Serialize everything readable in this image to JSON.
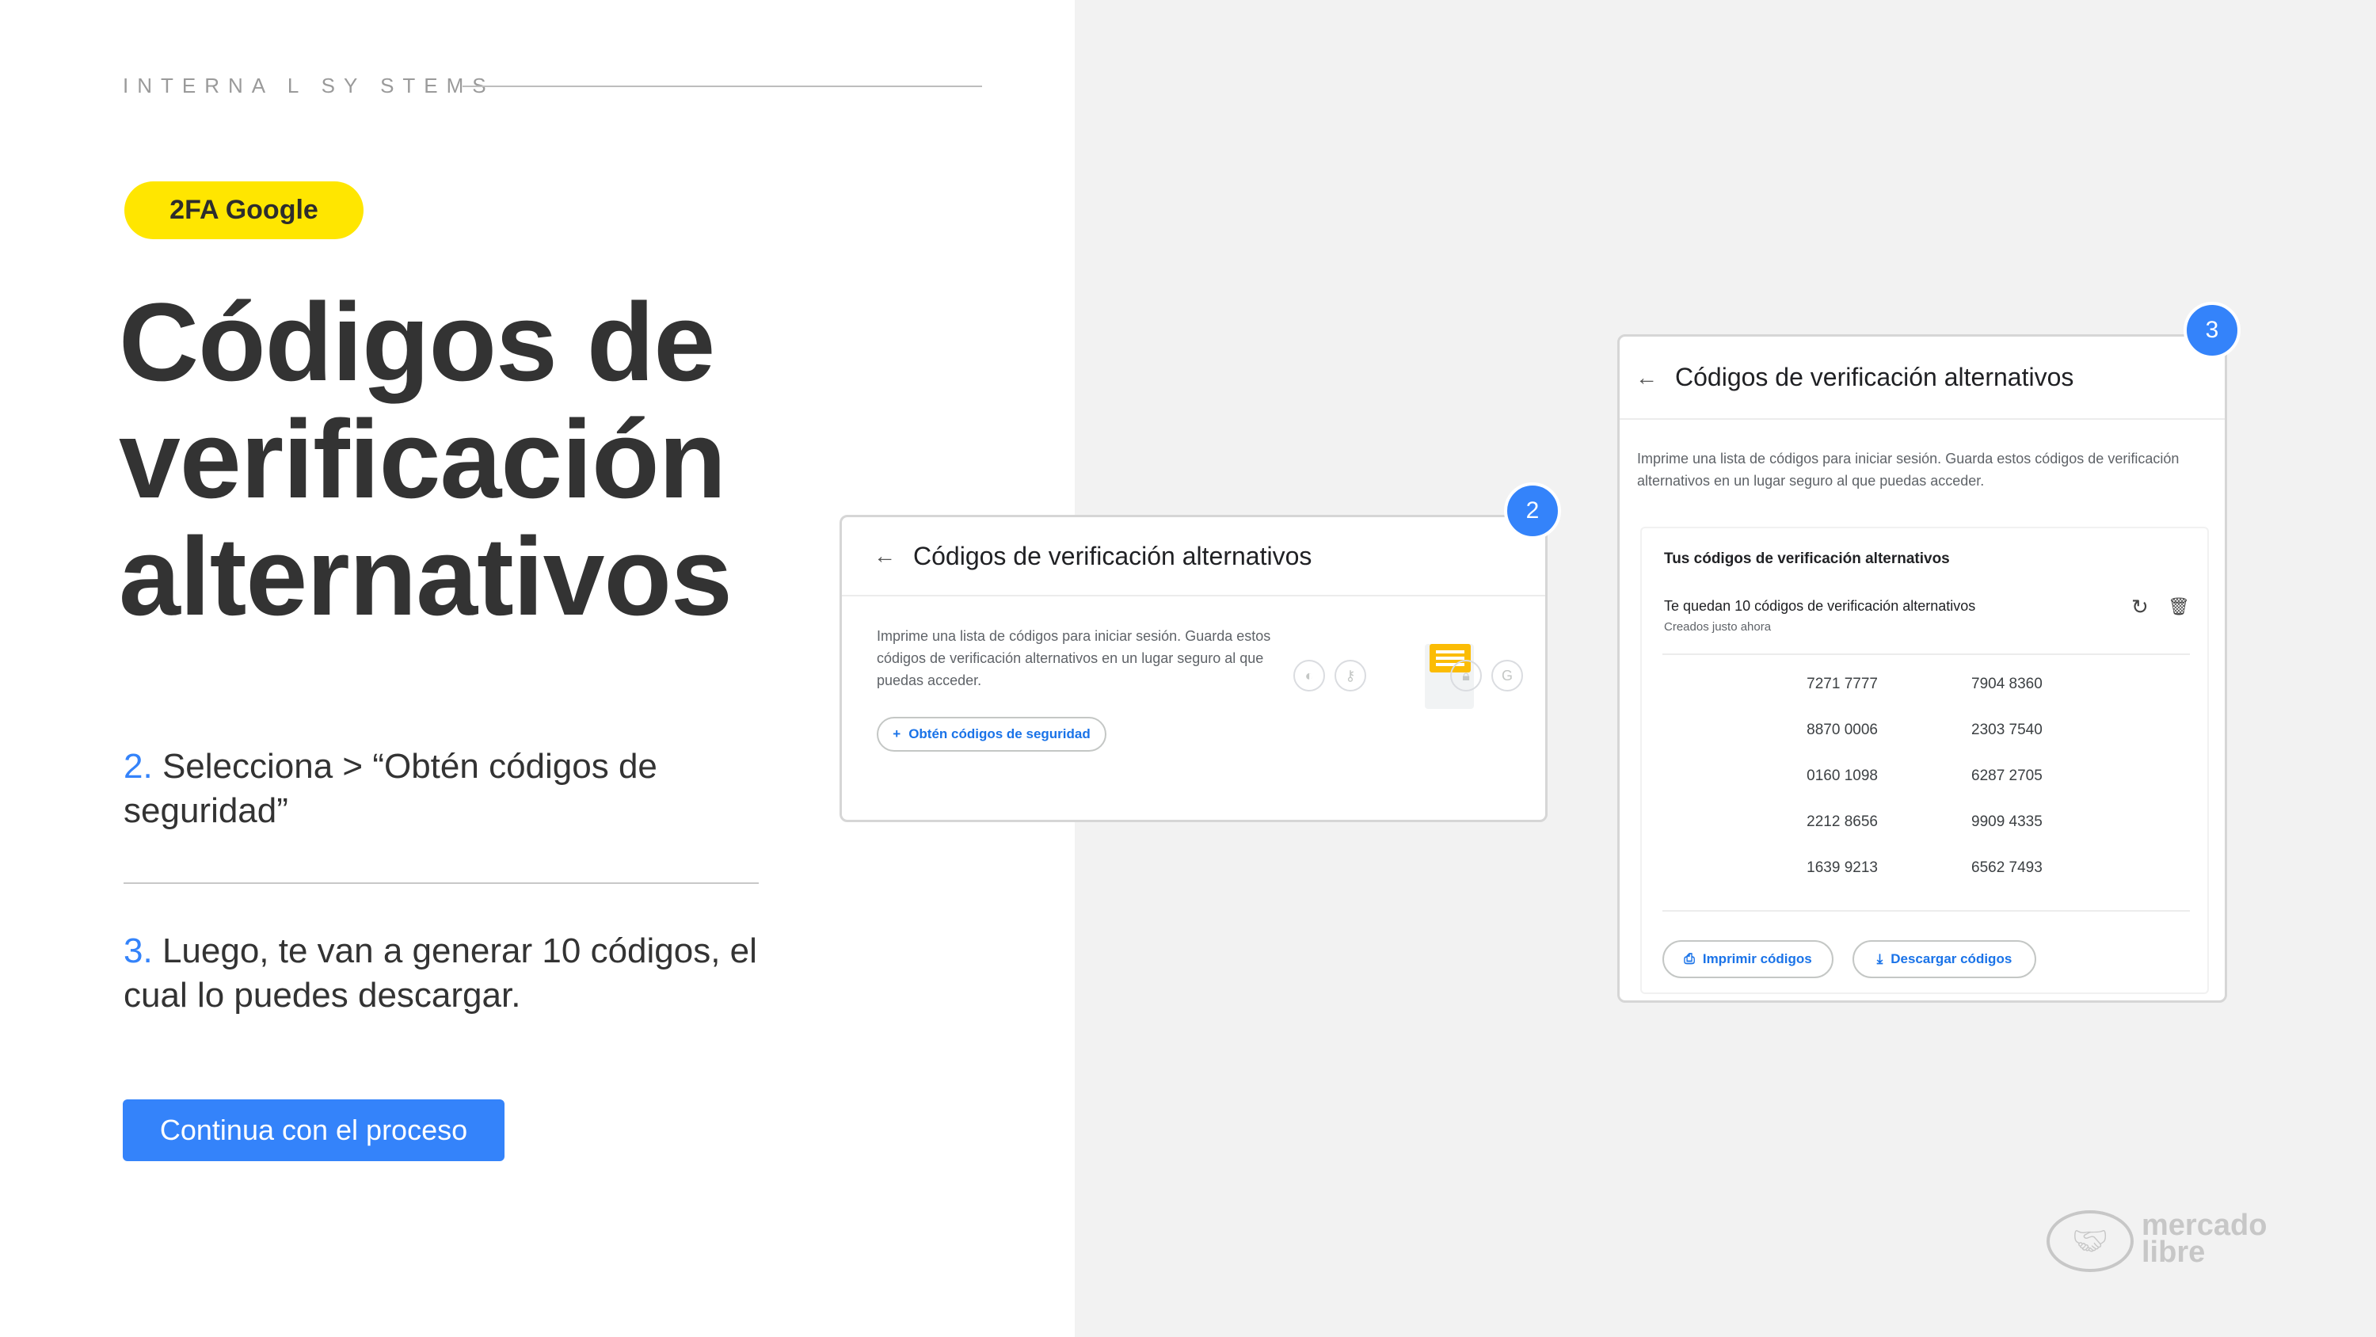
{
  "header": {
    "kicker": "INTERNA L SY STEMS",
    "tag": "2FA Google"
  },
  "title": {
    "line1": "Códigos de",
    "line2": "verificación",
    "line3": "alternativos"
  },
  "steps": [
    {
      "num": "2.",
      "text": "Selecciona > “Obtén códigos de seguridad”"
    },
    {
      "num": "3.",
      "text": "Luego, te van a generar 10 códigos, el cual lo puedes descargar."
    }
  ],
  "cta": {
    "label": "Continua con el proceso"
  },
  "card2": {
    "badge": "2",
    "title": "Códigos de verificación alternativos",
    "description": "Imprime una lista de códigos para iniciar sesión. Guarda estos códigos de verificación alternativos en un lugar seguro al que puedas acceder.",
    "button": "Obtén códigos de seguridad",
    "icons": [
      "contrast-icon",
      "key-icon",
      "lock-icon",
      "google-icon"
    ]
  },
  "card3": {
    "badge": "3",
    "title": "Códigos de verificación alternativos",
    "description": "Imprime una lista de códigos para iniciar sesión. Guarda estos códigos de verificación alternativos en un lugar seguro al que puedas acceder.",
    "box_title": "Tus códigos de verificación alternativos",
    "remaining": "Te quedan 10 códigos de verificación alternativos",
    "created": "Creados justo ahora",
    "codes": [
      [
        "7271 7777",
        "7904 8360"
      ],
      [
        "8870 0006",
        "2303 7540"
      ],
      [
        "0160 1098",
        "6287 2705"
      ],
      [
        "2212 8656",
        "9909 4335"
      ],
      [
        "1639 9213",
        "6562 7493"
      ]
    ],
    "print_button": "Imprimir códigos",
    "download_button": "Descargar códigos"
  },
  "logo": {
    "line1": "mercado",
    "line2": "libre"
  },
  "colors": {
    "accent": "#3483fa",
    "tag": "#ffe600",
    "panel": "#f2f2f2"
  }
}
